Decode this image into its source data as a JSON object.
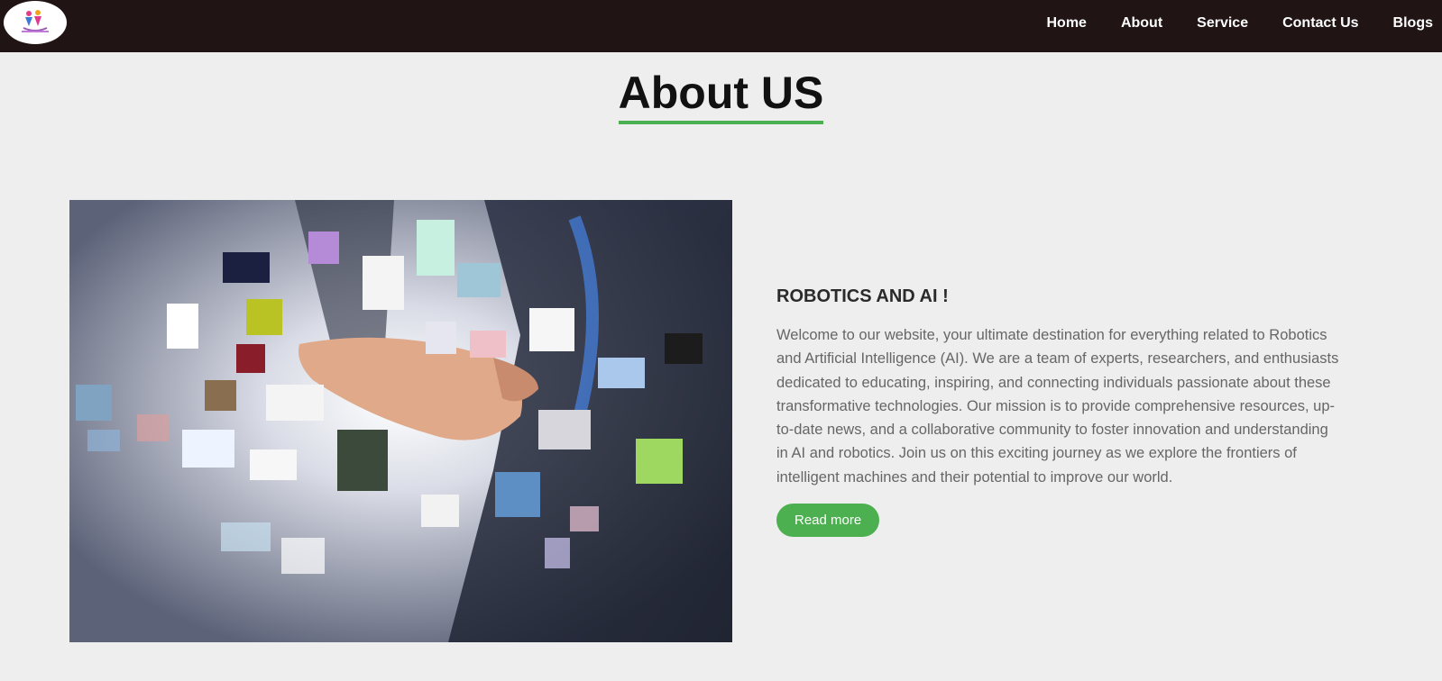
{
  "nav": {
    "links": [
      {
        "label": "Home"
      },
      {
        "label": "About"
      },
      {
        "label": "Service"
      },
      {
        "label": "Contact Us"
      },
      {
        "label": "Blogs"
      }
    ]
  },
  "page": {
    "title": "About US"
  },
  "about": {
    "heading": "ROBOTICS AND AI !",
    "paragraph": "Welcome to our website, your ultimate destination for everything related to Robotics and Artificial Intelligence (AI). We are a team of experts, researchers, and enthusiasts dedicated to educating, inspiring, and connecting individuals passionate about these transformative technologies. Our mission is to provide comprehensive resources, up-to-date news, and a collaborative community to foster innovation and understanding in AI and robotics. Join us on this exciting journey as we explore the frontiers of intelligent machines and their potential to improve our world.",
    "button_label": "Read more"
  },
  "colors": {
    "navbar_bg": "#201415",
    "page_bg": "#eeeeee",
    "accent_green": "#4caf50"
  }
}
